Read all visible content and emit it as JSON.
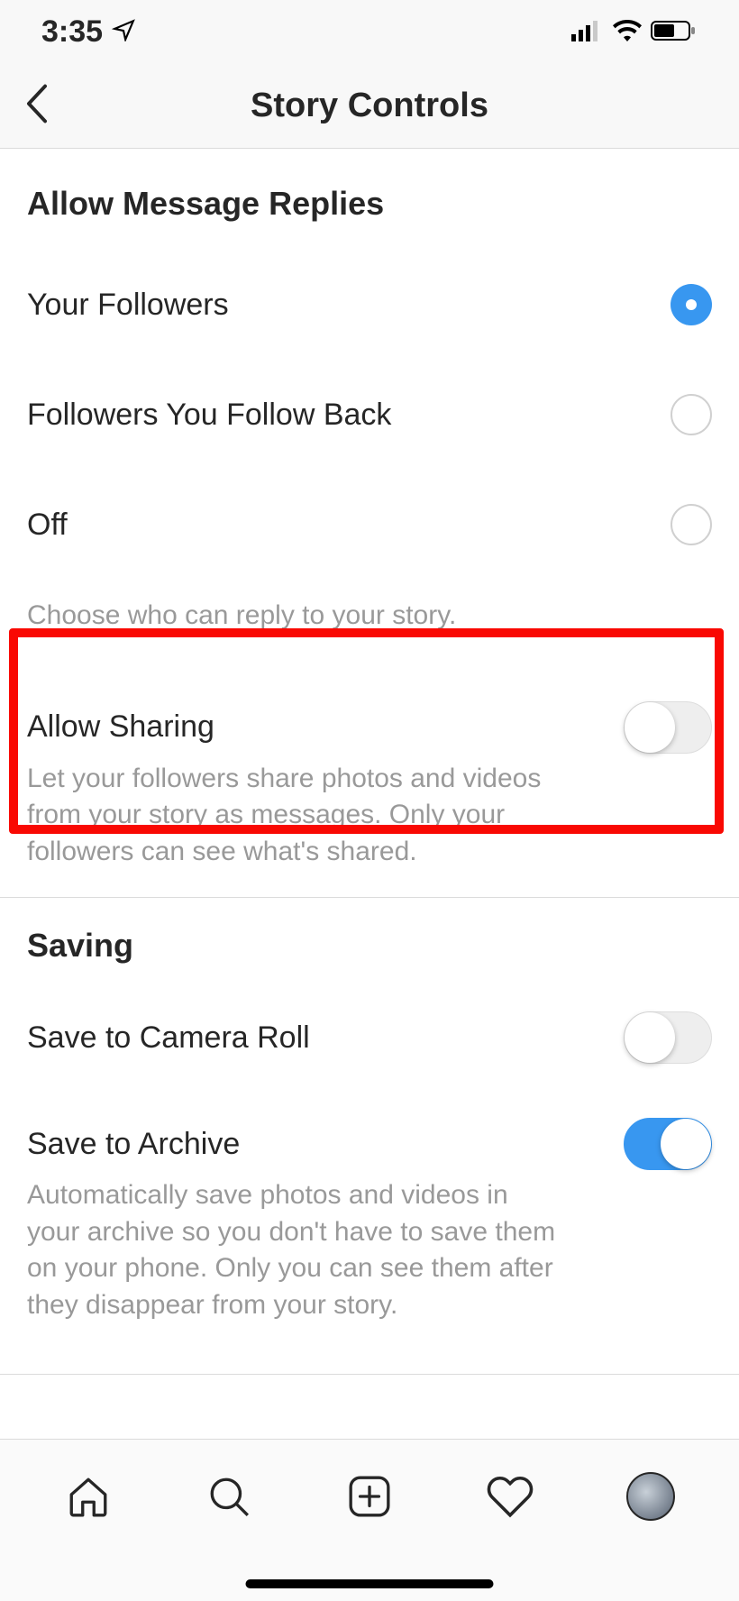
{
  "status": {
    "time": "3:35"
  },
  "header": {
    "title": "Story Controls"
  },
  "replies": {
    "title": "Allow Message Replies",
    "options": [
      {
        "label": "Your Followers",
        "selected": true
      },
      {
        "label": "Followers You Follow Back",
        "selected": false
      },
      {
        "label": "Off",
        "selected": false
      }
    ],
    "hint": "Choose who can reply to your story."
  },
  "sharing": {
    "label": "Allow Sharing",
    "desc": "Let your followers share photos and videos from your story as messages. Only your followers can see what's shared.",
    "on": false
  },
  "saving": {
    "title": "Saving",
    "camera_roll": {
      "label": "Save to Camera Roll",
      "on": false
    },
    "archive": {
      "label": "Save to Archive",
      "desc": "Automatically save photos and videos in your archive so you don't have to save them on your phone. Only you can see them after they disappear from your story.",
      "on": true
    }
  }
}
